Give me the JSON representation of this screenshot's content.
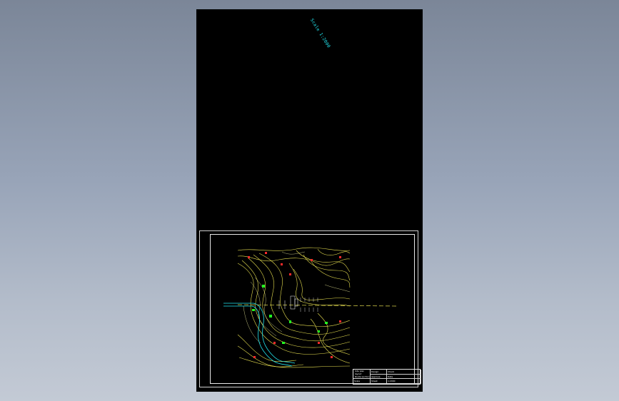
{
  "canvas": {
    "background_gradient": [
      "#7b8698",
      "#c3cad5"
    ],
    "sheet_color": "#000000"
  },
  "rotated_annotation": {
    "text": "Scale 1:2000",
    "color": "#22e6f0"
  },
  "title_block": {
    "drawing_title": "Site plan layout",
    "sub_title": "Route section",
    "cells": [
      "Design",
      "Check",
      "Approve",
      "Date",
      "Scale",
      "Sheet"
    ],
    "scale": "1:2000"
  },
  "colors": {
    "contour": "#e8e050",
    "contour_alt": "#f2f2a0",
    "marker_red": "#ff2a2a",
    "marker_green": "#22ff22",
    "road": "#22e6f0",
    "frame": "#e8e8e8"
  }
}
